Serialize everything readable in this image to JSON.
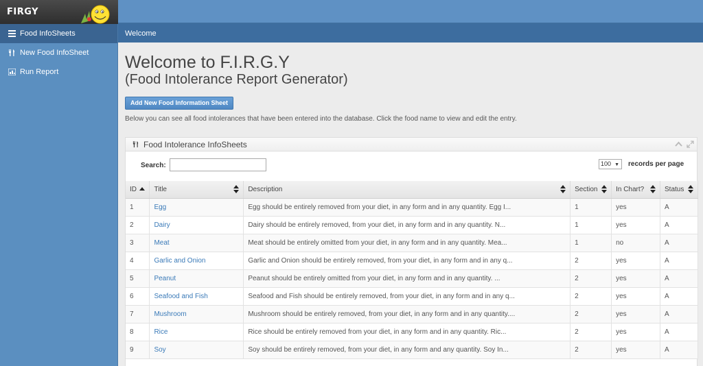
{
  "brand": {
    "name": "FIRGY"
  },
  "sidebar": {
    "items": [
      {
        "label": "Food InfoSheets",
        "icon": "list-icon"
      },
      {
        "label": "New Food InfoSheet",
        "icon": "cutlery-icon"
      },
      {
        "label": "Run Report",
        "icon": "chart-icon"
      }
    ]
  },
  "breadcrumb": "Welcome",
  "page": {
    "title": "Welcome to F.I.R.G.Y",
    "subtitle": "(Food Intolerance Report Generator)",
    "add_button": "Add New Food Information Sheet",
    "intro": "Below you can see all food intolerances that have been entered into the database. Click the food name to view and edit the entry."
  },
  "panel": {
    "title": "Food Intolerance InfoSheets",
    "search_label": "Search:",
    "search_value": "",
    "records_per_page": "100",
    "records_label": "records per page"
  },
  "table": {
    "columns": [
      "ID",
      "Title",
      "Description",
      "Section",
      "In Chart?",
      "Status"
    ],
    "rows": [
      {
        "id": "1",
        "title": "Egg",
        "description": "Egg should be entirely removed from your diet, in any form and in any quantity. Egg I...",
        "section": "1",
        "in_chart": "yes",
        "status": "A"
      },
      {
        "id": "2",
        "title": "Dairy",
        "description": "Dairy should be entirely removed, from your diet, in any form and in any quantity. N...",
        "section": "1",
        "in_chart": "yes",
        "status": "A"
      },
      {
        "id": "3",
        "title": "Meat",
        "description": "Meat should be entirely omitted from your diet, in any form and in any quantity. Mea...",
        "section": "1",
        "in_chart": "no",
        "status": "A"
      },
      {
        "id": "4",
        "title": "Garlic and Onion",
        "description": "Garlic and Onion should be entirely removed, from your diet, in any form and in any q...",
        "section": "2",
        "in_chart": "yes",
        "status": "A"
      },
      {
        "id": "5",
        "title": "Peanut",
        "description": "Peanut should be entirely omitted from your diet, in any form and in any quantity. ...",
        "section": "2",
        "in_chart": "yes",
        "status": "A"
      },
      {
        "id": "6",
        "title": "Seafood and Fish",
        "description": "Seafood and Fish should be entirely removed, from your diet, in any form and in any q...",
        "section": "2",
        "in_chart": "yes",
        "status": "A"
      },
      {
        "id": "7",
        "title": "Mushroom",
        "description": "Mushroom should be entirely removed, from your diet, in any form and in any quantity....",
        "section": "2",
        "in_chart": "yes",
        "status": "A"
      },
      {
        "id": "8",
        "title": "Rice",
        "description": "Rice should be entirely removed from your diet, in any form and in any quantity. Ric...",
        "section": "2",
        "in_chart": "yes",
        "status": "A"
      },
      {
        "id": "9",
        "title": "Soy",
        "description": "Soy should be entirely removed, from your diet, in any form and any quantity. Soy In...",
        "section": "2",
        "in_chart": "yes",
        "status": "A"
      }
    ]
  }
}
